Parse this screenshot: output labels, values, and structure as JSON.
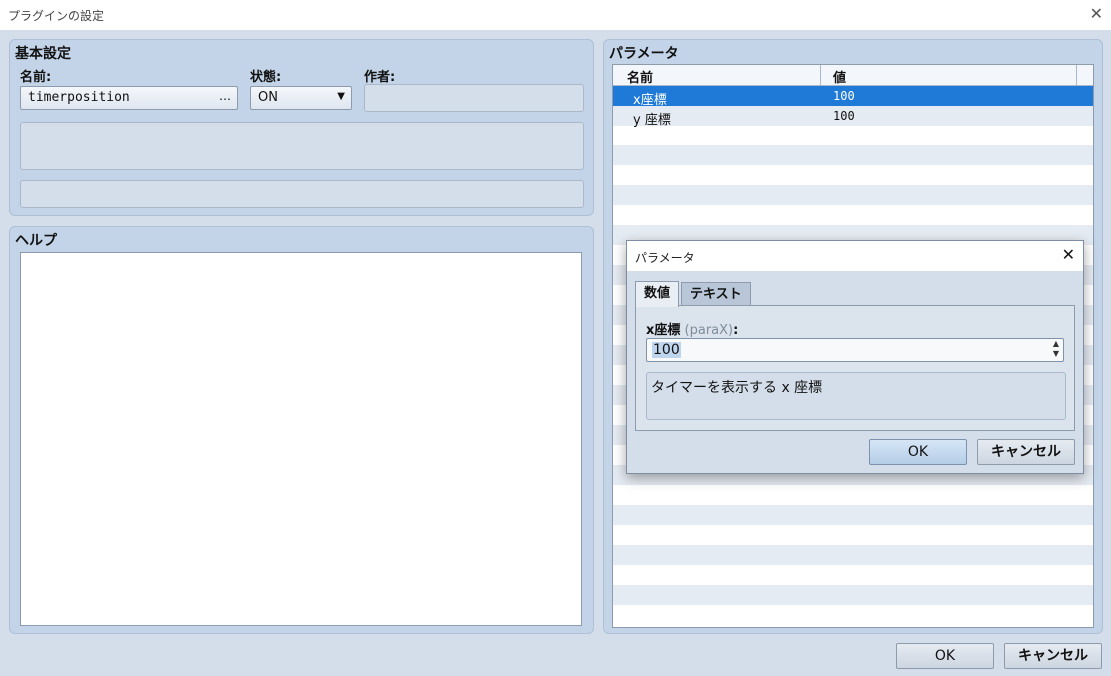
{
  "window": {
    "title": "プラグインの設定",
    "close_symbol": "✕"
  },
  "basic": {
    "title": "基本設定",
    "name_label": "名前:",
    "name_value": "timerposition",
    "name_button": "…",
    "status_label": "状態:",
    "status_value": "ON",
    "status_arrow": "▼",
    "author_label": "作者:",
    "author_value": "",
    "description_value": "",
    "extra_value": ""
  },
  "help": {
    "title": "ヘルプ",
    "content": ""
  },
  "parameters": {
    "title": "パラメータ",
    "columns": [
      "名前",
      "値"
    ],
    "rows": [
      {
        "name": "x座標",
        "value": "100",
        "selected": true
      },
      {
        "name": "y 座標",
        "value": "100",
        "selected": false
      }
    ]
  },
  "footer": {
    "ok_label": "OK",
    "cancel_label": "キャンセル"
  },
  "dialog": {
    "title": "パラメータ",
    "close_symbol": "✕",
    "tabs": [
      {
        "label": "数値",
        "active": true
      },
      {
        "label": "テキスト",
        "active": false
      }
    ],
    "field_label": "x座標",
    "field_key": "(paraX)",
    "field_colon": ":",
    "field_value": "100",
    "description": "タイマーを表示する x 座標",
    "ok_label": "OK",
    "cancel_label": "キャンセル"
  },
  "colors": {
    "background": "#d4deea",
    "panel": "#c3d4e8",
    "selection": "#1e7ad6"
  }
}
